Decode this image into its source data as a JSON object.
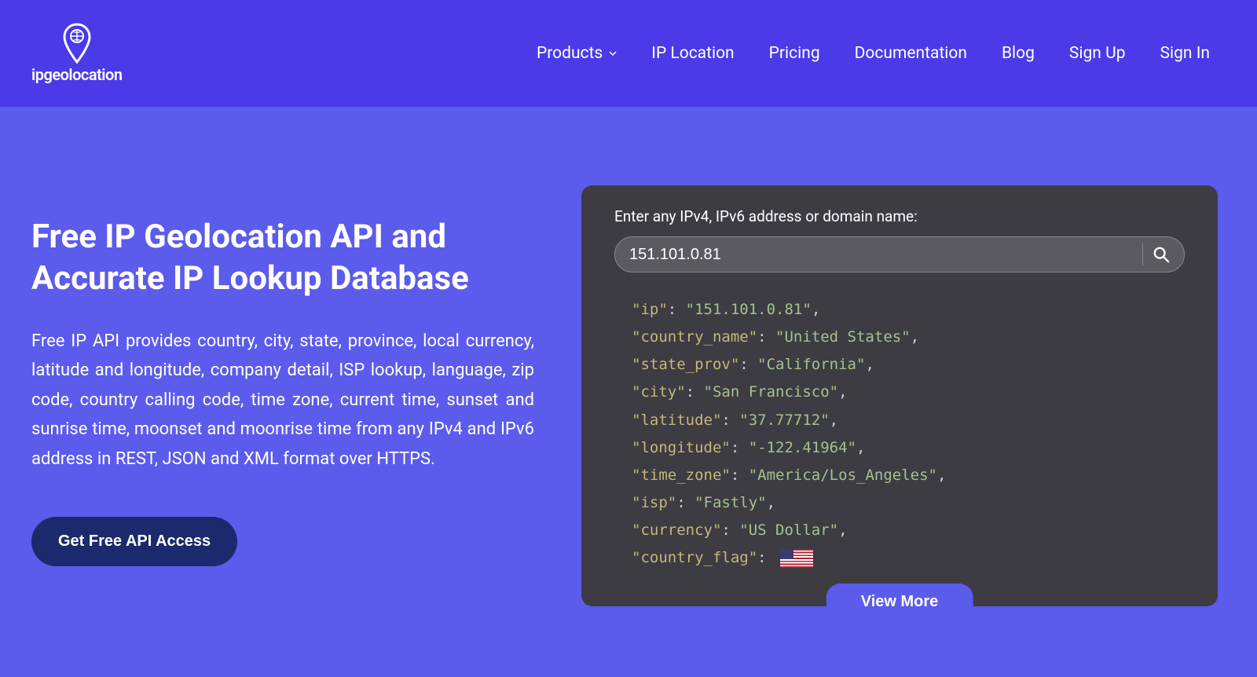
{
  "brand": {
    "name": "ipgeolocation"
  },
  "nav": {
    "products": "Products",
    "ip_location": "IP Location",
    "pricing": "Pricing",
    "documentation": "Documentation",
    "blog": "Blog",
    "sign_up": "Sign Up",
    "sign_in": "Sign In"
  },
  "hero": {
    "headline": "Free IP Geolocation API and Accurate IP Lookup Database",
    "description": "Free IP API provides country, city, state, province, local currency, latitude and longitude, company detail, ISP lookup, language, zip code, country calling code, time zone, current time, sunset and sunrise time, moonset and moonrise time from any IPv4 and IPv6 address in REST, JSON and XML format over HTTPS.",
    "cta": "Get Free API Access"
  },
  "lookup": {
    "label": "Enter any IPv4, IPv6 address or domain name:",
    "value": "151.101.0.81",
    "view_more": "View More",
    "result": {
      "ip": {
        "k": "\"ip\"",
        "v": "\"151.101.0.81\""
      },
      "country_name": {
        "k": "\"country_name\"",
        "v": "\"United States\""
      },
      "state_prov": {
        "k": "\"state_prov\"",
        "v": "\"California\""
      },
      "city": {
        "k": "\"city\"",
        "v": "\"San Francisco\""
      },
      "latitude": {
        "k": "\"latitude\"",
        "v": "\"37.77712\""
      },
      "longitude": {
        "k": "\"longitude\"",
        "v": "\"-122.41964\""
      },
      "time_zone": {
        "k": "\"time_zone\"",
        "v": "\"America/Los_Angeles\""
      },
      "isp": {
        "k": "\"isp\"",
        "v": "\"Fastly\""
      },
      "currency": {
        "k": "\"currency\"",
        "v": "\"US Dollar\""
      },
      "country_flag": {
        "k": "\"country_flag\""
      }
    }
  }
}
